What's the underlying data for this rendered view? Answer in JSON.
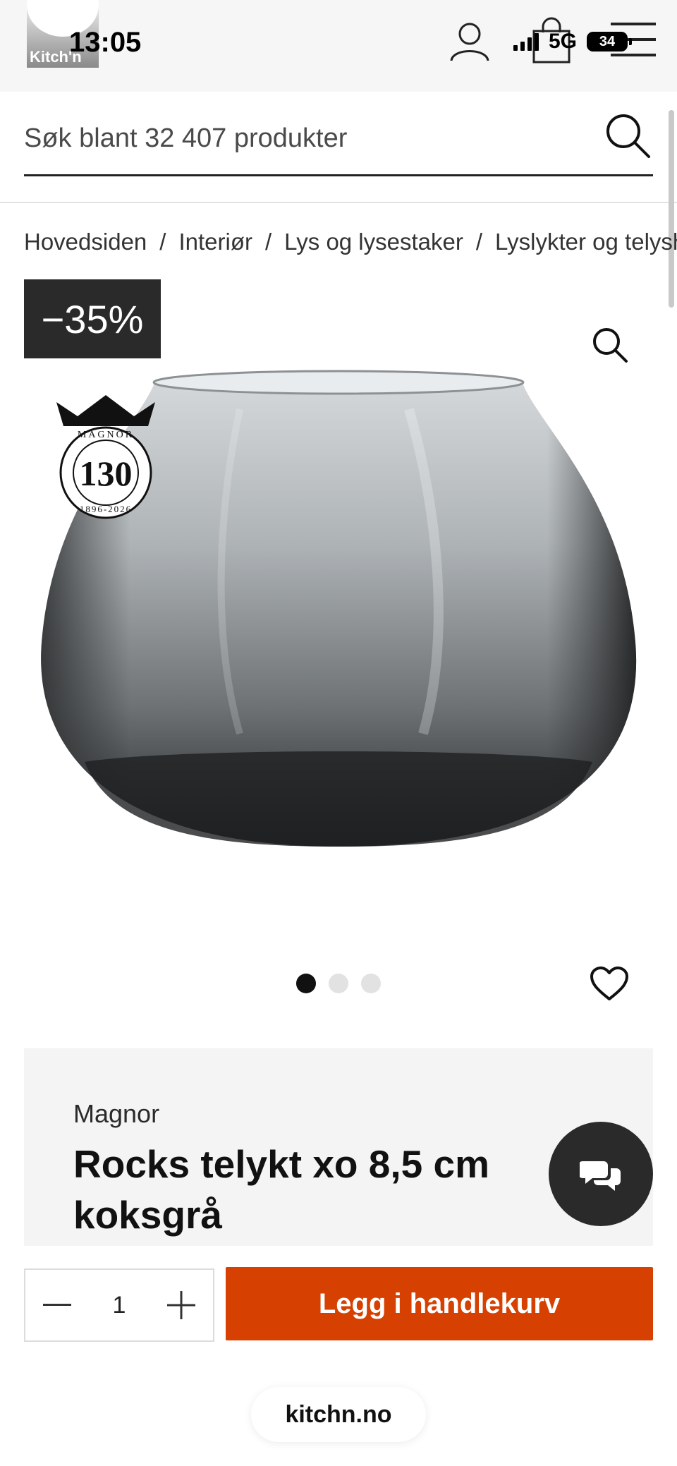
{
  "status_bar": {
    "time": "13:05",
    "network": "5G",
    "battery": "34"
  },
  "header": {
    "logo_text": "Kitch'n"
  },
  "search": {
    "placeholder": "Søk blant 32 407 produkter"
  },
  "breadcrumb": [
    "Hovedsiden",
    "Interiør",
    "Lys og lysestaker",
    "Lyslykter og telysholdere"
  ],
  "gallery": {
    "discount_label": "−35%",
    "badge": {
      "brand": "MAGNOR",
      "number": "130",
      "years": "1896-2026"
    },
    "dots_total": 3,
    "active_dot": 0
  },
  "product": {
    "brand": "Magnor",
    "title": "Rocks telykt xo 8,5 cm koksgrå"
  },
  "cart": {
    "quantity": "1",
    "add_label": "Legg i handlekurv"
  },
  "browser": {
    "url": "kitchn.no"
  },
  "colors": {
    "accent": "#d64000",
    "dark": "#2a2a2a",
    "panel": "#f4f4f4"
  }
}
